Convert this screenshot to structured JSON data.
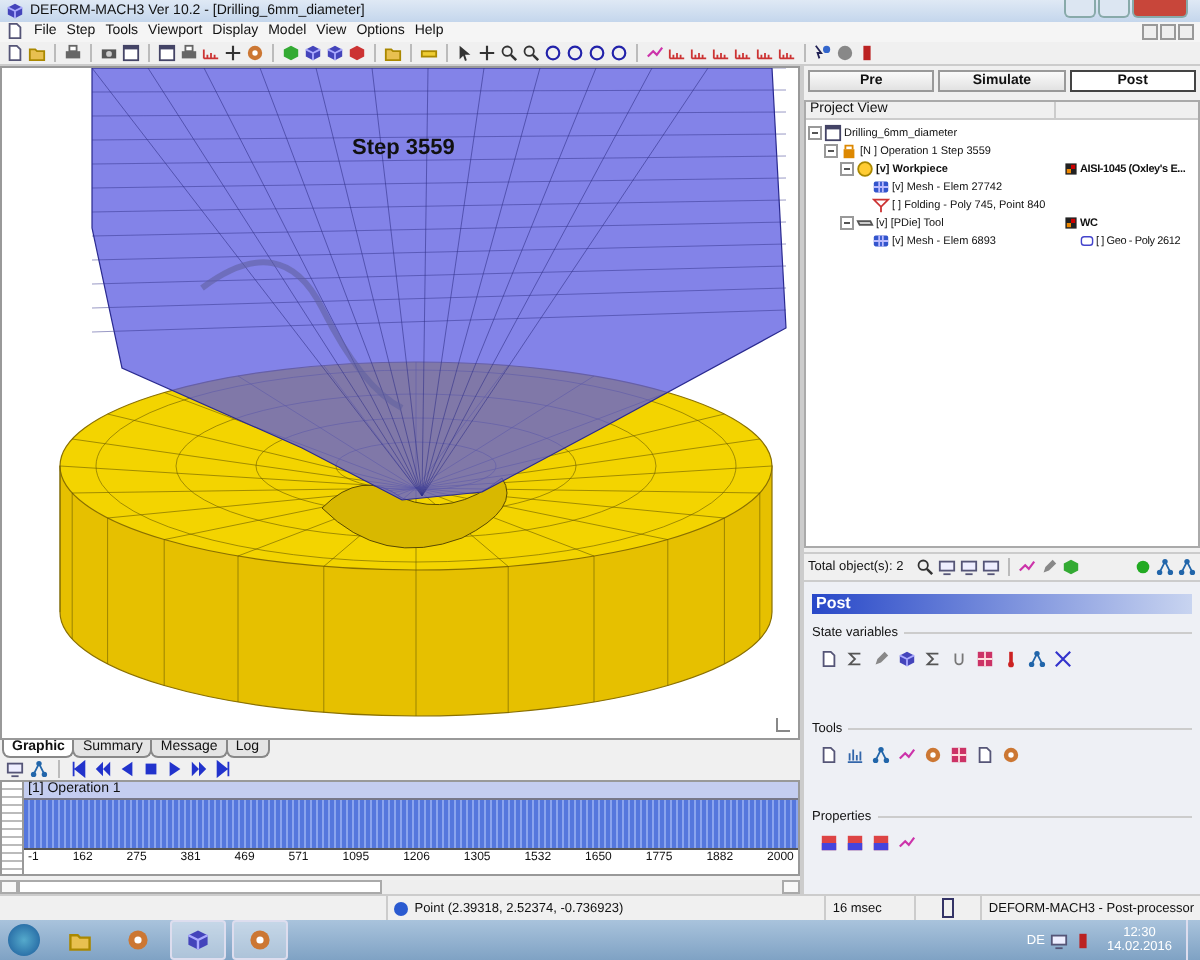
{
  "window": {
    "title": "DEFORM-MACH3  Ver 10.2 - [Drilling_6mm_diameter]"
  },
  "menu": [
    "File",
    "Step",
    "Tools",
    "Viewport",
    "Display",
    "Model",
    "View",
    "Options",
    "Help"
  ],
  "viewport": {
    "step_label": "Step 3559"
  },
  "bottom_tabs": [
    {
      "label": "Graphic",
      "selected": true
    },
    {
      "label": "Summary",
      "selected": false
    },
    {
      "label": "Message",
      "selected": false
    },
    {
      "label": "Log",
      "selected": false
    }
  ],
  "timeline": {
    "track_label": "[1] Operation 1",
    "ticks": [
      "-1",
      "162",
      "275",
      "381",
      "469",
      "571",
      "1095",
      "1206",
      "1305",
      "1532",
      "1650",
      "1775",
      "1882",
      "2000"
    ]
  },
  "mode_tabs": [
    {
      "label": "Pre",
      "selected": false
    },
    {
      "label": "Simulate",
      "selected": false
    },
    {
      "label": "Post",
      "selected": true
    }
  ],
  "project_view": {
    "header": "Project View",
    "tree": [
      {
        "kind": "project",
        "label": "Drilling_6mm_diameter",
        "selected": false,
        "expanded": true,
        "children": [
          {
            "kind": "operation",
            "label": "[N ] Operation 1  Step 3559",
            "selected": false,
            "expanded": true,
            "children": [
              {
                "kind": "workpiece",
                "label": "[v] Workpiece",
                "selected": true,
                "expanded": true,
                "value": {
                  "kind": "material",
                  "text": "AISI-1045 (Oxley's E..."
                },
                "children": [
                  {
                    "kind": "mesh",
                    "label": "[v] Mesh - Elem 27742",
                    "selected": false
                  },
                  {
                    "kind": "folding",
                    "label": "[ ] Folding - Poly 745, Point 840",
                    "selected": false
                  }
                ]
              },
              {
                "kind": "tool",
                "label": "[v] [PDie] Tool",
                "selected": false,
                "expanded": true,
                "value": {
                  "kind": "material",
                  "text": "WC"
                },
                "children": [
                  {
                    "kind": "mesh",
                    "label": "[v] Mesh - Elem 6893",
                    "selected": false,
                    "value": {
                      "kind": "geo",
                      "text": "[ ] Geo - Poly 2612"
                    }
                  }
                ]
              }
            ]
          }
        ]
      }
    ]
  },
  "objects_toolbar": {
    "count": "Total object(s): 2"
  },
  "post_panel": {
    "title": "Post",
    "sections": [
      {
        "title": "State variables"
      },
      {
        "title": "Tools"
      },
      {
        "title": "Properties"
      }
    ]
  },
  "status_bar": {
    "point": "Point (2.39318, 2.52374, -0.736923)",
    "time": "16 msec",
    "mode": "DEFORM-MACH3  - Post-processor"
  },
  "taskbar": {
    "language": "DE",
    "clock": "12:30",
    "date": "14.02.2016"
  }
}
